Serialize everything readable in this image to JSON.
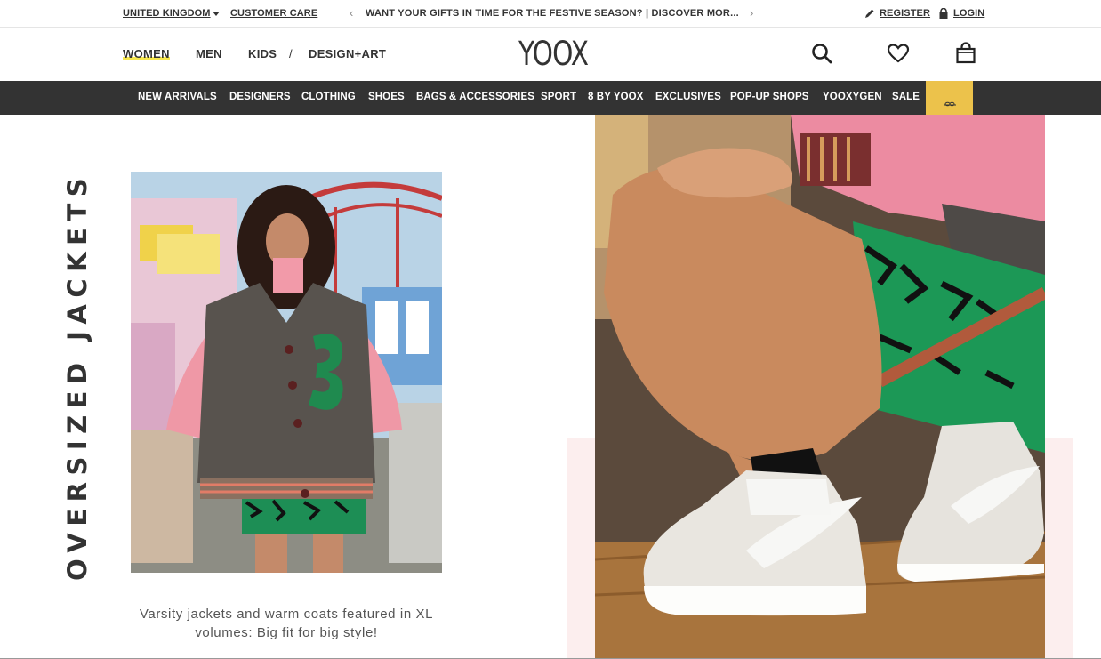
{
  "topbar": {
    "country": "UNITED KINGDOM",
    "customer_care": "CUSTOMER CARE",
    "promo": "WANT YOUR GIFTS IN TIME FOR THE FESTIVE SEASON? | DISCOVER MOR...",
    "register": "REGISTER",
    "login": "LOGIN"
  },
  "header": {
    "logo": "YOOX",
    "nav": [
      "WOMEN",
      "MEN",
      "KIDS",
      "/",
      "DESIGN+ART"
    ]
  },
  "categories": [
    "NEW ARRIVALS",
    "DESIGNERS",
    "CLOTHING",
    "SHOES",
    "BAGS & ACCESSORIES",
    "SPORT",
    "8 BY YOOX",
    "EXCLUSIVES",
    "POP-UP SHOPS",
    "YOOXYGEN",
    "SALE"
  ],
  "feature": {
    "title": "OVERSIZED JACKETS",
    "caption_line1": "Varsity jackets and warm coats featured in XL",
    "caption_line2": "volumes: Big fit for big style!"
  },
  "colors": {
    "accent_underline": "#f7e74d",
    "category_bar": "#333333",
    "gift_tab": "#ecc24b"
  }
}
